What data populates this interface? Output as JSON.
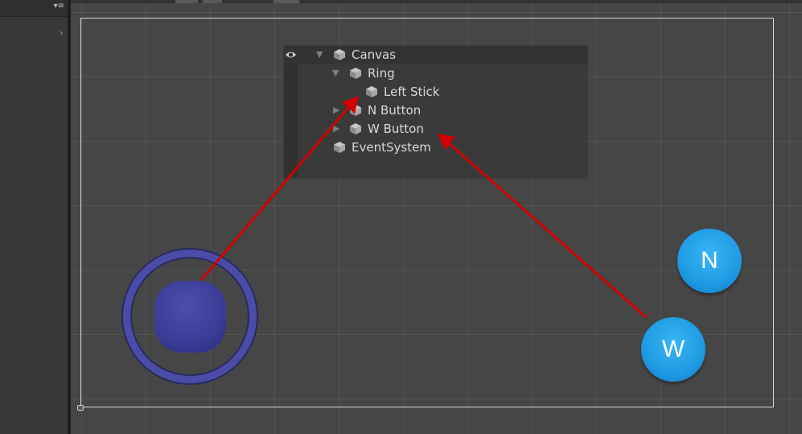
{
  "side_panel": {
    "menu_glyph": "▾≡",
    "chevron": "›"
  },
  "hierarchy": {
    "rows": [
      {
        "label": "Canvas",
        "fold": "▼",
        "icon": "cube-icon"
      },
      {
        "label": "Ring",
        "fold": "▼",
        "icon": "cube-icon"
      },
      {
        "label": "Left Stick",
        "fold": "",
        "icon": "cube-icon"
      },
      {
        "label": "N Button",
        "fold": "▶",
        "icon": "cube-icon"
      },
      {
        "label": "W Button",
        "fold": "▶",
        "icon": "cube-icon"
      },
      {
        "label": "EventSystem",
        "fold": "",
        "icon": "cube-icon"
      }
    ]
  },
  "scene": {
    "buttons": {
      "n_label": "N",
      "w_label": "W"
    }
  },
  "colors": {
    "annotation_arrow": "#d40000",
    "action_button": "#1e9be3",
    "joystick": "#3a3c98"
  }
}
